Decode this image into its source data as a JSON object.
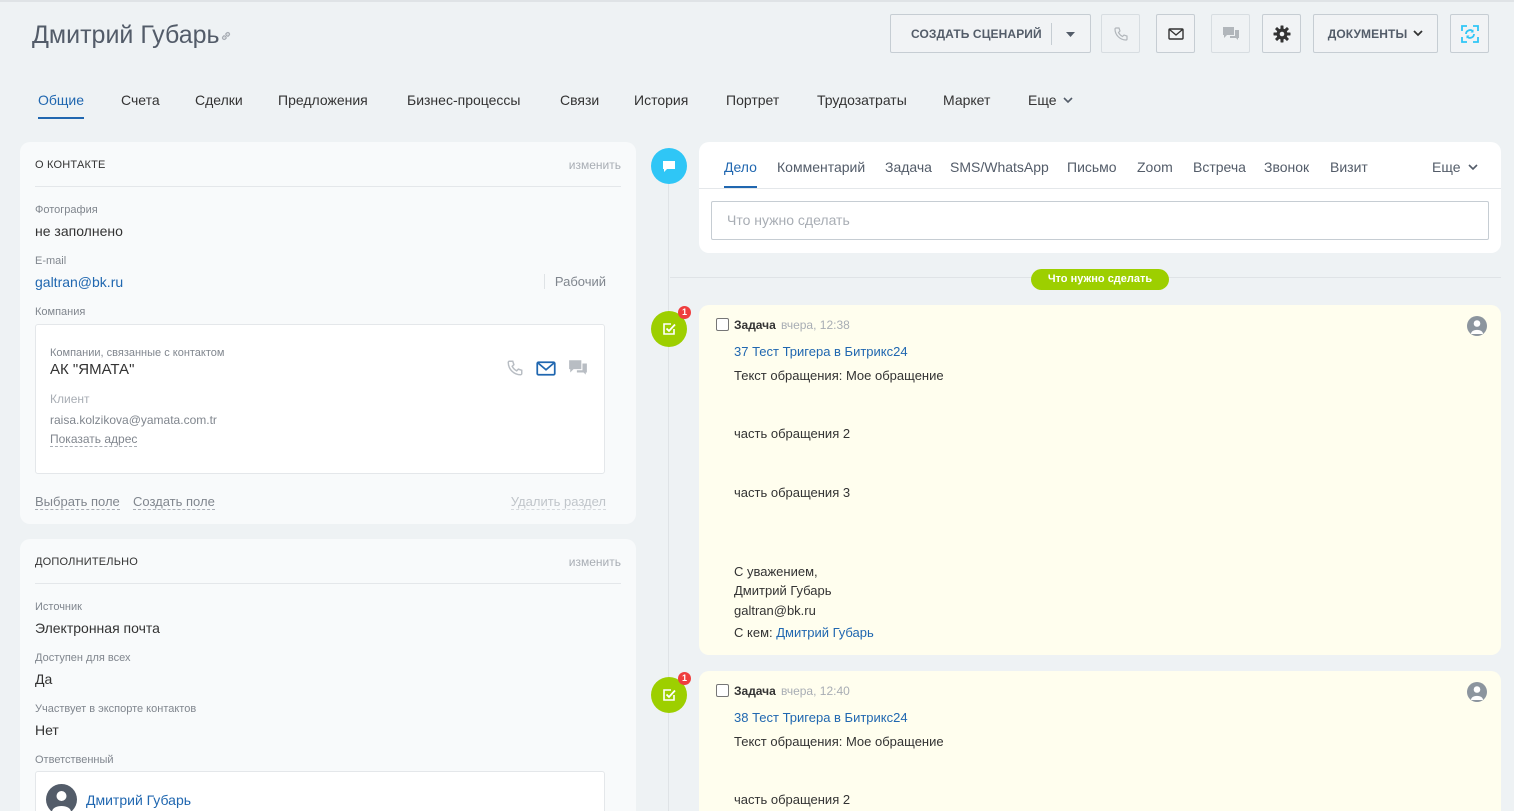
{
  "header": {
    "title": "Дмитрий Губарь",
    "create_scenario_label": "СОЗДАТЬ СЦЕНАРИЙ",
    "documents_label": "ДОКУМЕНТЫ"
  },
  "tabs": [
    "Общие",
    "Счета",
    "Сделки",
    "Предложения",
    "Бизнес-процессы",
    "Связи",
    "История",
    "Портрет",
    "Трудозатраты",
    "Маркет",
    "Еще"
  ],
  "about": {
    "heading": "О КОНТАКТЕ",
    "edit": "изменить",
    "photo_label": "Фотография",
    "photo_value": "не заполнено",
    "email_label": "E-mail",
    "email_value": "galtran@bk.ru",
    "email_type": "Рабочий",
    "company_label": "Компания",
    "company": {
      "linked_label": "Компании, связанные с контактом",
      "name": "АК \"ЯМАТА\"",
      "client": "Клиент",
      "email": "raisa.kolzikova@yamata.com.tr",
      "show_address": "Показать адрес"
    },
    "select_field": "Выбрать поле",
    "create_field": "Создать поле",
    "delete_section": "Удалить раздел"
  },
  "extra": {
    "heading": "ДОПОЛНИТЕЛЬНО",
    "edit": "изменить",
    "source_label": "Источник",
    "source_value": "Электронная почта",
    "public_label": "Доступен для всех",
    "public_value": "Да",
    "export_label": "Участвует в экспорте контактов",
    "export_value": "Нет",
    "responsible_label": "Ответственный",
    "responsible_name": "Дмитрий Губарь"
  },
  "composer": {
    "tabs": [
      "Дело",
      "Комментарий",
      "Задача",
      "SMS/WhatsApp",
      "Письмо",
      "Zoom",
      "Встреча",
      "Звонок",
      "Визит"
    ],
    "more": "Еще",
    "placeholder": "Что нужно сделать"
  },
  "timeline": {
    "todo_pill": "Что нужно сделать",
    "tasks": [
      {
        "badge": "1",
        "type": "Задача",
        "time": "вчера, 12:38",
        "title": "37 Тест Тригера в Битрикс24",
        "lines": [
          "Текст обращения: Мое обращение",
          "часть обращения 2",
          "часть обращения 3",
          "С уважением,",
          "Дмитрий Губарь",
          "galtran@bk.ru"
        ],
        "with_label": "С кем:",
        "with_name": "Дмитрий Губарь"
      },
      {
        "badge": "1",
        "type": "Задача",
        "time": "вчера, 12:40",
        "title": "38 Тест Тригера в Битрикс24",
        "lines": [
          "Текст обращения: Мое обращение",
          "часть обращения 2"
        ]
      }
    ]
  },
  "colors": {
    "accent": "#2067b0",
    "timeline_blue": "#2fc6f6",
    "task_green": "#9dcf00",
    "badge_red": "#ef3e3e",
    "task_bg": "#fffeee"
  }
}
